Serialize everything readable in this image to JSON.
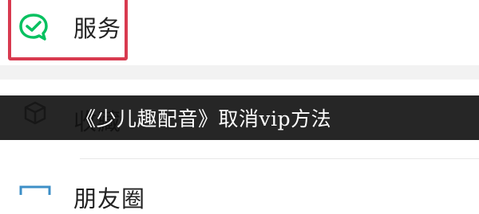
{
  "menu": {
    "service": {
      "label": "服务",
      "icon": "service-check-icon",
      "accent_color": "#07c160"
    },
    "favorites": {
      "label": "收藏",
      "icon": "cube-icon"
    },
    "moments": {
      "label": "朋友圈",
      "icon": "album-icon"
    }
  },
  "overlay": {
    "title": "《少儿趣配音》取消vip方法"
  },
  "colors": {
    "highlight_border": "#d83a4f",
    "banner_background": "#0e0e0e"
  }
}
